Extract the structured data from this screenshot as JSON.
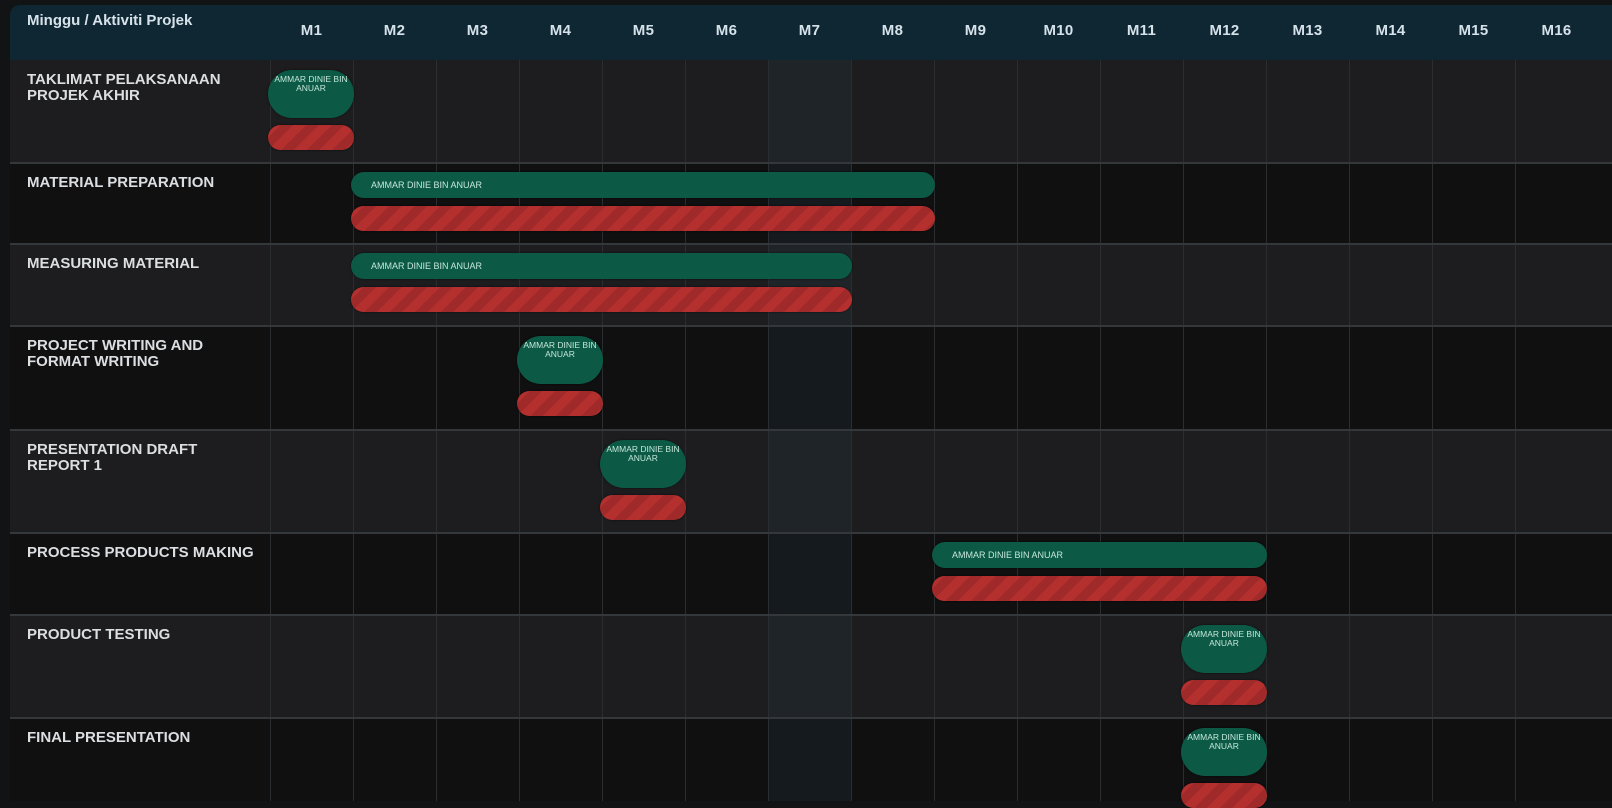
{
  "chart_data": {
    "type": "gantt",
    "corner_label": "Minggu / Aktiviti Projek",
    "weeks": [
      "M1",
      "M2",
      "M3",
      "M4",
      "M5",
      "M6",
      "M7",
      "M8",
      "M9",
      "M10",
      "M11",
      "M12",
      "M13",
      "M14",
      "M15",
      "M16"
    ],
    "activities": [
      {
        "name": "TAKLIMAT PELAKSANAAN PROJEK AKHIR",
        "person": "AMMAR DINIE BIN ANUAR",
        "plan_start": 1,
        "plan_end": 1,
        "actual_start": 1,
        "actual_end": 1
      },
      {
        "name": "MATERIAL PREPARATION",
        "person": "AMMAR DINIE BIN ANUAR",
        "plan_start": 2,
        "plan_end": 8,
        "actual_start": 2,
        "actual_end": 8
      },
      {
        "name": "MEASURING MATERIAL",
        "person": "AMMAR DINIE BIN ANUAR",
        "plan_start": 2,
        "plan_end": 7,
        "actual_start": 2,
        "actual_end": 7
      },
      {
        "name": "PROJECT WRITING AND FORMAT WRITING",
        "person": "AMMAR DINIE BIN ANUAR",
        "plan_start": 4,
        "plan_end": 4,
        "actual_start": 4,
        "actual_end": 4
      },
      {
        "name": "PRESENTATION DRAFT REPORT 1",
        "person": "AMMAR DINIE BIN ANUAR",
        "plan_start": 5,
        "plan_end": 5,
        "actual_start": 5,
        "actual_end": 5
      },
      {
        "name": "PROCESS PRODUCTS MAKING",
        "person": "AMMAR DINIE BIN ANUAR",
        "plan_start": 9,
        "plan_end": 12,
        "actual_start": 9,
        "actual_end": 12
      },
      {
        "name": "PRODUCT TESTING",
        "person": "AMMAR DINIE BIN ANUAR",
        "plan_start": 12,
        "plan_end": 12,
        "actual_start": 12,
        "actual_end": 12
      },
      {
        "name": "FINAL PRESENTATION",
        "person": "AMMAR DINIE BIN ANUAR",
        "plan_start": 12,
        "plan_end": 12,
        "actual_start": 12,
        "actual_end": 12
      }
    ],
    "colors": {
      "plan": "#0c5a45",
      "actual": "#b3302e",
      "header_bg": "#0f2633"
    }
  }
}
